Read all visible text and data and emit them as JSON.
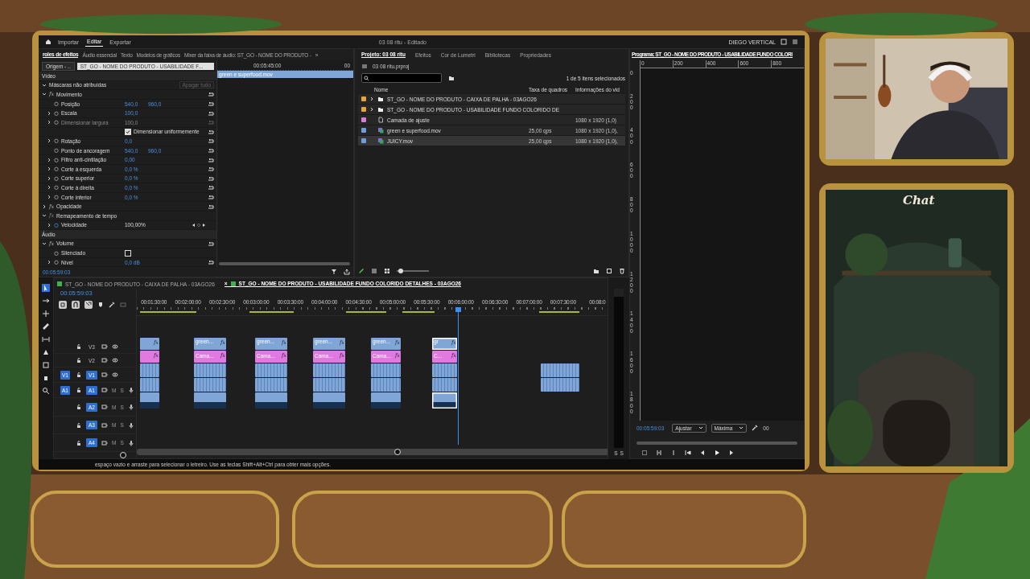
{
  "app_bar": {
    "tabs": [
      {
        "label": "Importar",
        "selected": false
      },
      {
        "label": "Editar",
        "selected": true
      },
      {
        "label": "Exportar",
        "selected": false
      }
    ],
    "title": "03 08 ritu - Editado",
    "workspace": "DIEGO VERTICAL"
  },
  "effect_controls": {
    "tabs": [
      {
        "label": "roles de efeitos",
        "selected": true
      },
      {
        "label": "Áudio essencial",
        "selected": false
      },
      {
        "label": "Texto",
        "selected": false
      },
      {
        "label": "Modelos de gráficos",
        "selected": false
      },
      {
        "label": "Mixer da faixa de áudio: ST_GO - NOME DO PRODUTO -",
        "selected": false
      }
    ],
    "more": "»",
    "source": "Origem - ..",
    "sequence": "ST_GO - NOME DO PRODUTO - USABILIDADE F...",
    "rows": [
      {
        "kind": "section",
        "label": "Vídeo"
      },
      {
        "kind": "masks",
        "label": "Máscaras não atribuídas",
        "button": "Apagar tudo",
        "expanded": true
      },
      {
        "kind": "group",
        "label": "Movimento",
        "fx": "fx",
        "fx_enabled": true,
        "expanded": true,
        "reset": true
      },
      {
        "kind": "prop",
        "label": "Posição",
        "values": [
          "540,0",
          "960,0"
        ],
        "expandable": false,
        "disabled": false
      },
      {
        "kind": "prop",
        "label": "Escala",
        "values": [
          "100,0"
        ],
        "expandable": true,
        "disabled": false
      },
      {
        "kind": "prop",
        "label": "Dimensionar largura",
        "values": [
          "100,0"
        ],
        "expandable": true,
        "disabled": true
      },
      {
        "kind": "checkbox",
        "label": "Dimensionar uniformemente",
        "checked": true
      },
      {
        "kind": "prop",
        "label": "Rotação",
        "values": [
          "0,0"
        ],
        "expandable": true,
        "disabled": false
      },
      {
        "kind": "prop",
        "label": "Ponto de ancoragem",
        "values": [
          "540,0",
          "960,0"
        ],
        "expandable": false,
        "disabled": false
      },
      {
        "kind": "prop",
        "label": "Filtro anti-cintilação",
        "values": [
          "0,00"
        ],
        "expandable": true,
        "disabled": false
      },
      {
        "kind": "prop",
        "label": "Corte à esquerda",
        "values": [
          "0,0 %"
        ],
        "expandable": true,
        "disabled": false
      },
      {
        "kind": "prop",
        "label": "Corte superior",
        "values": [
          "0,0 %"
        ],
        "expandable": true,
        "disabled": false
      },
      {
        "kind": "prop",
        "label": "Corte à direita",
        "values": [
          "0,0 %"
        ],
        "expandable": true,
        "disabled": false
      },
      {
        "kind": "prop",
        "label": "Corte inferior",
        "values": [
          "0,0 %"
        ],
        "expandable": true,
        "disabled": false
      },
      {
        "kind": "group",
        "label": "Opacidade",
        "fx": "fx",
        "fx_enabled": true,
        "expanded": false,
        "reset": true
      },
      {
        "kind": "group",
        "label": "Remapeamento de tempo",
        "fx": "fx",
        "fx_enabled": false,
        "expanded": true,
        "reset": false
      },
      {
        "kind": "speed",
        "label": "Velocidade",
        "values": [
          "100,00%"
        ],
        "expandable": true,
        "disabled": false
      },
      {
        "kind": "section",
        "label": "Áudio"
      },
      {
        "kind": "group",
        "label": "Volume",
        "fx": "fx",
        "fx_enabled": true,
        "expanded": true,
        "reset": true
      },
      {
        "kind": "toggle",
        "label": "Silenciado",
        "checked": false
      },
      {
        "kind": "prop",
        "label": "Nível",
        "values": [
          "0,0 dB"
        ],
        "expandable": true,
        "disabled": false
      }
    ],
    "mini_timeline": {
      "time": "00:05:45:00",
      "time_end": "00",
      "clip": "green e superfood.mov"
    },
    "timecode": "00:05:59:03"
  },
  "project": {
    "tabs": [
      {
        "label": "Projeto: 03 08 ritu",
        "selected": true
      },
      {
        "label": "Efeitos",
        "selected": false
      },
      {
        "label": "Cor de Lumetri",
        "selected": false
      },
      {
        "label": "Bibliotecas",
        "selected": false
      },
      {
        "label": "Propriedades",
        "selected": false
      }
    ],
    "file": "03 08 ritu.prproj",
    "zoom_slider": {
      "level": 0.05
    },
    "count": "1 de 5 itens selecionados",
    "columns": [
      "Nome",
      "Taxa de quadros",
      "Informações do vid"
    ],
    "items": [
      {
        "kind": "folder",
        "color": "#e8a33c",
        "name": "ST_GO - NOME DO PRODUTO - CAIXA DE PALHA - 03AGO26",
        "selected": false
      },
      {
        "kind": "folder",
        "color": "#e8a33c",
        "name": "ST_GO - NOME DO PRODUTO - USABILIDADE FUNDO COLORIDO DE",
        "selected": false
      },
      {
        "kind": "adjustment",
        "color": "#e07ad8",
        "name": "Camada de ajuste",
        "info": "1080 x 1920 (1,0)",
        "selected": false
      },
      {
        "kind": "clip",
        "color": "#6f9fd8",
        "name": "green e superfood.mov",
        "fps": "25,00 qps",
        "info": "1080 x 1920 (1,0),",
        "selected": false
      },
      {
        "kind": "clip",
        "color": "#6f9fd8",
        "name": "JUICY.mov",
        "fps": "25,00 qps",
        "info": "1080 x 1920 (1,0),",
        "selected": true
      }
    ]
  },
  "program": {
    "title": "Programa: ST_GO - NOME DO PRODUTO - USABILIDADE FUNDO COLORI",
    "hruler": [
      "0",
      "200",
      "400",
      "600",
      "800"
    ],
    "vruler": [
      "0",
      "200",
      "400",
      "600",
      "800",
      "1000",
      "1200",
      "1400",
      "1600",
      "1800"
    ],
    "timecode": "00:05:59:03",
    "fit": "Ajustar",
    "quality": "Máxima",
    "end": "00"
  },
  "timeline": {
    "tabs": [
      {
        "label": "ST_GO - NOME DO PRODUTO - CAIXA DE PALHA - 03AGO26",
        "selected": false
      },
      {
        "label": "ST_GO - NOME DO PRODUTO - USABILIDADE FUNDO COLORIDO DETALHES - 03AGO26",
        "selected": true,
        "close": "×"
      }
    ],
    "timecode": "00:05:59:03",
    "ruler": [
      "00:01:30:00",
      "00:02:00:00",
      "00:02:30:00",
      "00:03:00:00",
      "00:03:30:00",
      "00:04:00:00",
      "00:04:30:00",
      "00:05:00:00",
      "00:05:30:00",
      "00:06:00:00",
      "00:06:30:00",
      "00:07:00:00",
      "00:07:30:00",
      "00:08:0"
    ],
    "tracks": [
      {
        "name": "V3",
        "kind": "video",
        "targeted": false
      },
      {
        "name": "V2",
        "kind": "video",
        "targeted": false
      },
      {
        "name": "V1",
        "kind": "video",
        "targeted": true,
        "source": "V1"
      },
      {
        "name": "A1",
        "kind": "audio",
        "targeted": true,
        "source": "A1",
        "mute": "M",
        "solo": "S"
      },
      {
        "name": "A2",
        "kind": "audio",
        "targeted": true,
        "mute": "M",
        "solo": "S"
      },
      {
        "name": "A3",
        "kind": "audio",
        "targeted": true,
        "mute": "M",
        "solo": "S"
      },
      {
        "name": "A4",
        "kind": "audio",
        "targeted": true,
        "mute": "M",
        "solo": "S"
      }
    ],
    "clips": [
      {
        "kind": "full",
        "top_badge": "fx",
        "middle_badge": "fx",
        "selected": false
      },
      {
        "kind": "full",
        "top": "green...",
        "middle": "Cama...",
        "top_badge": "fx",
        "middle_badge": "fx",
        "selected": false
      },
      {
        "kind": "full",
        "top": "green...",
        "middle": "Cama...",
        "top_badge": "fx",
        "middle_badge": "fx",
        "selected": false
      },
      {
        "kind": "full",
        "top": "green...",
        "middle": "Cama...",
        "top_badge": "fx",
        "middle_badge": "fx",
        "selected": false
      },
      {
        "kind": "full",
        "top": "green...",
        "middle": "Cama...",
        "top_badge": "fx",
        "middle_badge": "fx",
        "selected": false
      },
      {
        "kind": "full",
        "top": "gr",
        "middle": "C...",
        "top_badge": "fx",
        "middle_badge": "fx",
        "selected": true
      },
      {
        "kind": "av",
        "selected": false
      }
    ],
    "meter": [
      "S",
      "S"
    ],
    "status": "espaço vazio e arraste para selecionar o letreiro. Use as teclas Shift+Alt+Ctrl para obter mais opções."
  },
  "chat": {
    "title": "Chat"
  }
}
